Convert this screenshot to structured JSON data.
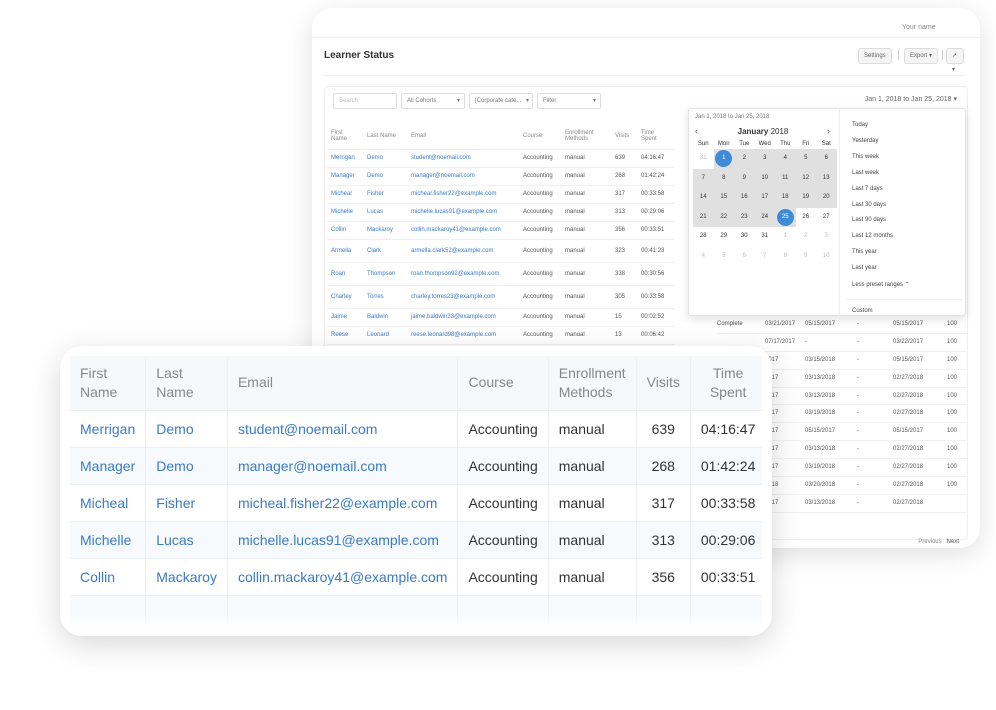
{
  "back": {
    "title": "Learner Status",
    "settings_label": "Settings",
    "export_label": "Export",
    "chevron": "▾",
    "user_label": "Your name",
    "search_placeholder": "Search",
    "cohorts_value": "All Cohorts",
    "category_value": "[Corporate cate...",
    "filter_value": "Filter",
    "range_label": "Jan 1, 2018 to Jan 25, 2018",
    "columns": [
      "First Name",
      "Last Name",
      "Email",
      "Course",
      "Enrollment Methods",
      "Visits",
      "Time Spent"
    ],
    "rows": [
      [
        "Merrigan",
        "Demo",
        "student@noemail.com",
        "Accounting",
        "manual",
        "639",
        "04:16:47"
      ],
      [
        "Manager",
        "Demo",
        "manager@noemail.com",
        "Accounting",
        "manual",
        "268",
        "01:42:24"
      ],
      [
        "Micheal",
        "Fisher",
        "micheal.fisher22@example.com",
        "Accounting",
        "manual",
        "317",
        "00:33:58"
      ],
      [
        "Michelle",
        "Lucas",
        "michelle.lucas91@example.com",
        "Accounting",
        "manual",
        "313",
        "00:29:06"
      ],
      [
        "Collin",
        "Mackaroy",
        "collin.mackaroy41@example.com",
        "Accounting",
        "manual",
        "356",
        "00:33:51"
      ],
      [
        "Armella",
        "Clark",
        "armella.clark52@example.com",
        "Accounting",
        "manual",
        "323",
        "00:41:23"
      ],
      [
        "Roan",
        "Thompson",
        "roan.thompson92@example.com",
        "Accounting",
        "manual",
        "338",
        "00:30:56"
      ],
      [
        "Charley",
        "Torres",
        "charley.torres23@example.com",
        "Accounting",
        "manual",
        "305",
        "00:33:58"
      ],
      [
        "Jaime",
        "Baldwin",
        "jaime.baldwin33@example.com",
        "Accounting",
        "manual",
        "15",
        "00:02:52"
      ],
      [
        "Reese",
        "Leonard",
        "reese.leonard98@example.com",
        "Accounting",
        "manual",
        "13",
        "00:06:42"
      ]
    ],
    "extra_rows": [
      [
        "Complete",
        "03/21/2017",
        "05/15/2017",
        "-",
        "05/15/2017",
        "100"
      ],
      [
        "",
        "07/17/2017",
        "-",
        "-",
        "03/22/2017",
        "100"
      ],
      [
        "",
        "2017",
        "03/15/2018",
        "-",
        "05/15/2017",
        "100"
      ],
      [
        "",
        "2017",
        "03/13/2018",
        "-",
        "02/27/2018",
        "100"
      ],
      [
        "",
        "2017",
        "03/13/2018",
        "-",
        "02/27/2018",
        "100"
      ],
      [
        "",
        "2017",
        "03/19/2018",
        "-",
        "02/27/2018",
        "100"
      ],
      [
        "",
        "2017",
        "05/15/2017",
        "-",
        "05/15/2017",
        "100"
      ],
      [
        "",
        "2017",
        "03/13/2018",
        "-",
        "02/27/2018",
        "100"
      ],
      [
        "",
        "2017",
        "03/19/2018",
        "-",
        "02/27/2018",
        "100"
      ],
      [
        "",
        "2018",
        "03/20/2018",
        "-",
        "02/27/2018",
        "100"
      ],
      [
        "",
        "2017",
        "03/13/2018",
        "-",
        "02/27/2018",
        ""
      ]
    ],
    "pager_prev": "Previous",
    "pager_next": "Next",
    "calendar": {
      "range_text": "Jan 1, 2018 to Jan 25, 2018",
      "month": "January",
      "year": "2018",
      "prev": "‹",
      "next": "›",
      "dow": [
        "Sun",
        "Mon",
        "Tue",
        "Wed",
        "Thu",
        "Fri",
        "Sat"
      ],
      "weeks": [
        [
          "31",
          "1",
          "2",
          "3",
          "4",
          "5",
          "6"
        ],
        [
          "7",
          "8",
          "9",
          "10",
          "11",
          "12",
          "13"
        ],
        [
          "14",
          "15",
          "16",
          "17",
          "18",
          "19",
          "20"
        ],
        [
          "21",
          "22",
          "23",
          "24",
          "25",
          "26",
          "27"
        ],
        [
          "28",
          "29",
          "30",
          "31",
          "1",
          "2",
          "3"
        ],
        [
          "4",
          "5",
          "6",
          "7",
          "8",
          "9",
          "10"
        ]
      ],
      "presets": [
        "Today",
        "Yesterday",
        "This week",
        "Last week",
        "Last 7 days",
        "Last 30 days",
        "Last 90 days",
        "Last 12 months",
        "This year",
        "Last year",
        "Less preset ranges ⌃",
        "Custom"
      ]
    }
  },
  "front": {
    "columns": [
      "First\nName",
      "Last\nName",
      "Email",
      "Course",
      "Enrollment\nMethods",
      "Visits",
      "Time\nSpent"
    ],
    "rows": [
      [
        "Merrigan",
        "Demo",
        "student@noemail.com",
        "Accounting",
        "manual",
        "639",
        "04:16:47"
      ],
      [
        "Manager",
        "Demo",
        "manager@noemail.com",
        "Accounting",
        "manual",
        "268",
        "01:42:24"
      ],
      [
        "Micheal",
        "Fisher",
        "micheal.fisher22@example.com",
        "Accounting",
        "manual",
        "317",
        "00:33:58"
      ],
      [
        "Michelle",
        "Lucas",
        "michelle.lucas91@example.com",
        "Accounting",
        "manual",
        "313",
        "00:29:06"
      ],
      [
        "Collin",
        "Mackaroy",
        "collin.mackaroy41@example.com",
        "Accounting",
        "manual",
        "356",
        "00:33:51"
      ],
      [
        "Armella",
        "Clark",
        "armella.clark52@example.com",
        "Accounting",
        "manual",
        "323",
        "00:41:23"
      ]
    ]
  },
  "colors": {
    "link": "#3a7bc8",
    "selected": "#3d8bd9"
  }
}
